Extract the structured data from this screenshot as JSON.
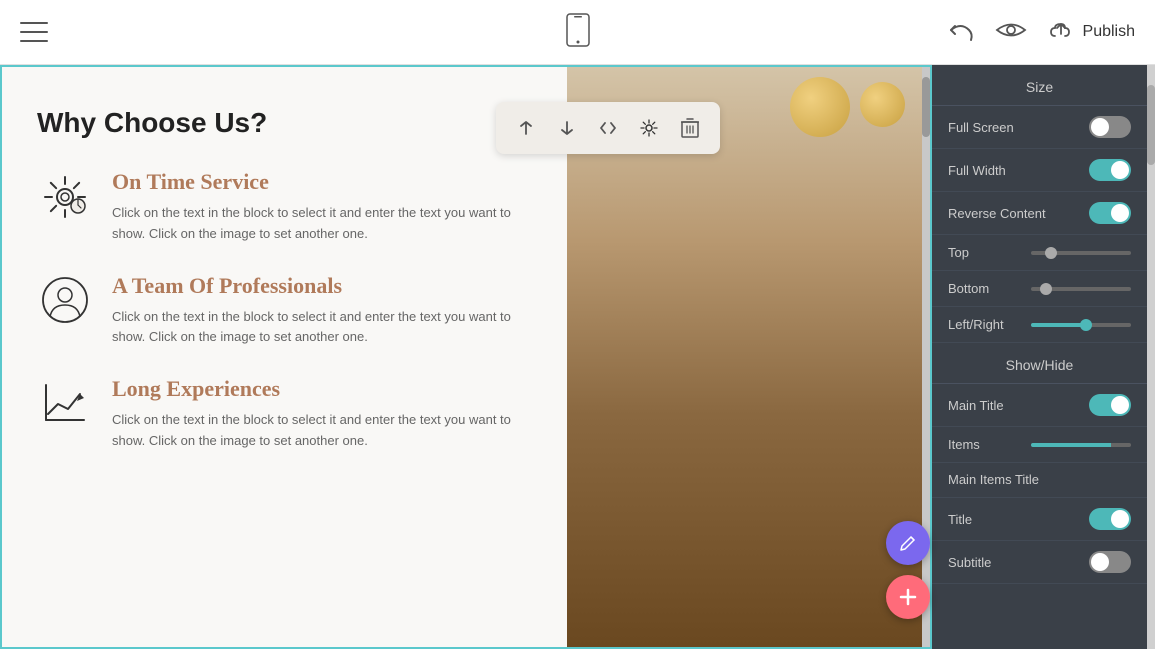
{
  "header": {
    "menu_icon": "hamburger-icon",
    "phone_icon": "phone-icon",
    "undo_label": "↩",
    "eye_label": "👁",
    "publish_label": "Publish",
    "upload_icon": "upload-cloud-icon"
  },
  "canvas": {
    "section_title": "Why Choose Us?",
    "features": [
      {
        "id": "on-time",
        "icon": "gear-icon",
        "title": "On Time Service",
        "description": "Click on the text in the block to select it and enter the text you want to show. Click on the image to set another one."
      },
      {
        "id": "team",
        "icon": "person-icon",
        "title": "A Team Of Professionals",
        "description": "Click on the text in the block to select it and enter the text you want to show. Click on the image to set another one."
      },
      {
        "id": "experience",
        "icon": "chart-icon",
        "title": "Long Experiences",
        "description": "Click on the text in the block to select it and enter the text you want to show. Click on the image to set another one."
      }
    ]
  },
  "toolbar": {
    "buttons": [
      {
        "id": "move-up",
        "icon": "arrow-up-icon",
        "label": "↑"
      },
      {
        "id": "move-down",
        "icon": "arrow-down-icon",
        "label": "↓"
      },
      {
        "id": "code",
        "icon": "code-icon",
        "label": "</>"
      },
      {
        "id": "settings",
        "icon": "settings-icon",
        "label": "⚙"
      },
      {
        "id": "delete",
        "icon": "delete-icon",
        "label": "🗑"
      }
    ]
  },
  "settings_panel": {
    "size_section": "Size",
    "show_hide_section": "Show/Hide",
    "rows": [
      {
        "id": "full-screen",
        "label": "Full Screen",
        "type": "toggle",
        "value": false
      },
      {
        "id": "full-width",
        "label": "Full Width",
        "type": "toggle",
        "value": true
      },
      {
        "id": "reverse-content",
        "label": "Reverse Content",
        "type": "toggle",
        "value": true
      },
      {
        "id": "top",
        "label": "Top",
        "type": "slider",
        "slider_class": "top-slider"
      },
      {
        "id": "bottom",
        "label": "Bottom",
        "type": "slider",
        "slider_class": "bottom-slider"
      },
      {
        "id": "left-right",
        "label": "Left/Right",
        "type": "slider",
        "slider_class": "lr-slider"
      }
    ],
    "show_hide_rows": [
      {
        "id": "main-title",
        "label": "Main Title",
        "type": "toggle",
        "value": true
      },
      {
        "id": "items",
        "label": "Items",
        "type": "items-slider"
      },
      {
        "id": "title",
        "label": "Title",
        "type": "toggle",
        "value": true
      },
      {
        "id": "subtitle",
        "label": "Subtitle",
        "type": "toggle",
        "value": false
      }
    ],
    "extra_label": "Main Items Title"
  },
  "fab": {
    "edit_icon": "pencil-icon",
    "add_icon": "plus-icon"
  }
}
